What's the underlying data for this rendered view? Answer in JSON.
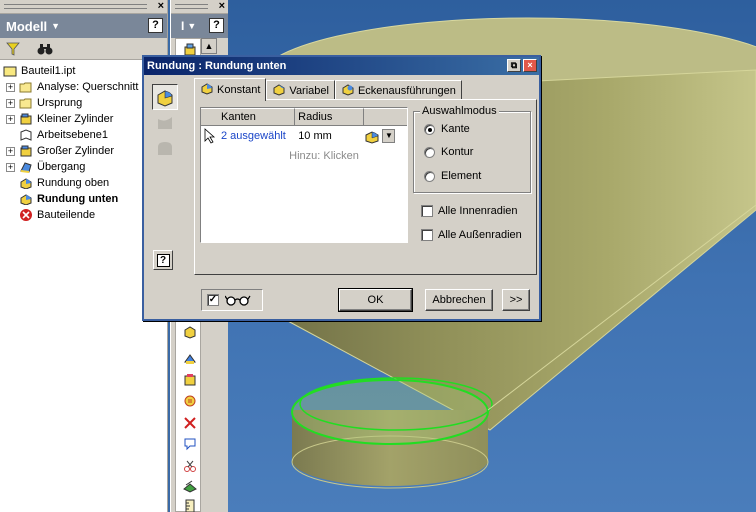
{
  "browser": {
    "title": "Modell",
    "help_glyph": "?",
    "tree": [
      {
        "label": "Bauteil1.ipt",
        "icon": "part-icon",
        "expand": "",
        "indent": 0,
        "bold": false
      },
      {
        "label": "Analyse: Querschnitt",
        "icon": "folder-icon",
        "expand": "+",
        "indent": 1,
        "bold": false
      },
      {
        "label": "Ursprung",
        "icon": "folder-icon",
        "expand": "+",
        "indent": 1,
        "bold": false
      },
      {
        "label": "Kleiner Zylinder",
        "icon": "extrusion-icon",
        "expand": "+",
        "indent": 1,
        "bold": false
      },
      {
        "label": "Arbeitsebene1",
        "icon": "workplane-icon",
        "expand": "",
        "indent": 1,
        "bold": false
      },
      {
        "label": "Großer Zylinder",
        "icon": "extrusion-icon",
        "expand": "+",
        "indent": 1,
        "bold": false
      },
      {
        "label": "Übergang",
        "icon": "loft-icon",
        "expand": "+",
        "indent": 1,
        "bold": false
      },
      {
        "label": "Rundung oben",
        "icon": "fillet-icon",
        "expand": "",
        "indent": 1,
        "bold": false
      },
      {
        "label": "Rundung unten",
        "icon": "fillet-icon",
        "expand": "",
        "indent": 1,
        "bold": true
      },
      {
        "label": "Bauteilende",
        "icon": "end-of-part-icon",
        "expand": "",
        "indent": 1,
        "bold": false
      }
    ]
  },
  "toolcol": {
    "title": "I",
    "help_glyph": "?",
    "scroll_up": "▲"
  },
  "dialog": {
    "title": "Rundung : Rundung unten",
    "tabs": [
      {
        "label": "Konstant",
        "active": true
      },
      {
        "label": "Variabel",
        "active": false
      },
      {
        "label": "Eckenausführungen",
        "active": false
      }
    ],
    "grid": {
      "headers": [
        "Kanten",
        "Radius"
      ],
      "rows": [
        {
          "edges": "2 ausgewählt",
          "radius": "10 mm"
        }
      ],
      "add_hint": "Hinzu: Klicken"
    },
    "selection_mode": {
      "legend": "Auswahlmodus",
      "options": [
        {
          "label": "Kante",
          "checked": true
        },
        {
          "label": "Kontur",
          "checked": false
        },
        {
          "label": "Element",
          "checked": false
        }
      ]
    },
    "checkboxes": [
      {
        "label": "Alle Innenradien",
        "checked": false
      },
      {
        "label": "Alle Außenradien",
        "checked": false
      }
    ],
    "preview_checked": true,
    "ok_label": "OK",
    "cancel_label": "Abbrechen",
    "more_label": ">>",
    "help_glyph": "?"
  },
  "colors": {
    "viewport_bg": "#3f72b2",
    "model_fill": "#9a9a5a",
    "edge_highlight": "#22dd22",
    "title_bar": "#0a246a",
    "link_blue": "#1a45c8"
  }
}
